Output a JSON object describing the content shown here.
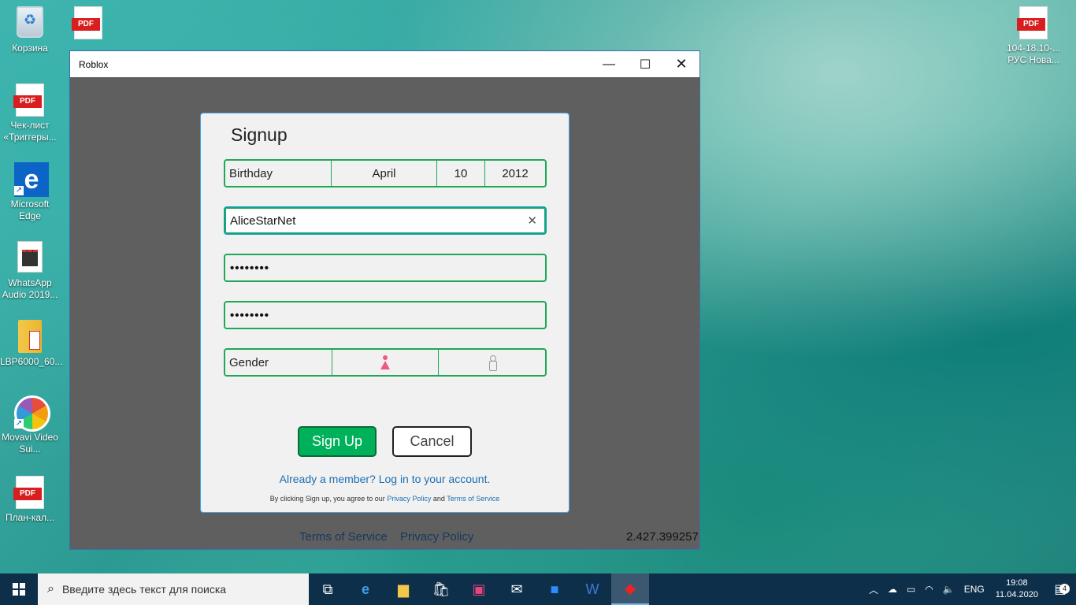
{
  "desktop": {
    "icons": [
      {
        "label": "Корзина"
      },
      {
        "label": "Чек-лист «Триггеры..."
      },
      {
        "label": "Microsoft Edge"
      },
      {
        "label": "WhatsApp Audio 2019..."
      },
      {
        "label": "LBP6000_60..."
      },
      {
        "label": "Movavi Video Sui..."
      },
      {
        "label": "План-кал..."
      },
      {
        "label": "104-18.10-... РУС Нова..."
      }
    ],
    "pdf_tag": "PDF"
  },
  "window": {
    "title": "Roblox",
    "minimize": "—",
    "maximize": "☐",
    "close": "✕"
  },
  "signup": {
    "heading": "Signup",
    "birthday": {
      "label": "Birthday",
      "month": "April",
      "day": "10",
      "year": "2012"
    },
    "username": {
      "value": "AliceStarNet",
      "clear": "✕"
    },
    "password": {
      "value": "••••••••"
    },
    "confirm_password": {
      "value": "••••••••"
    },
    "gender": {
      "label": "Gender"
    },
    "signup_button": "Sign Up",
    "cancel_button": "Cancel",
    "login_link": "Already a member? Log in to your account.",
    "legal_prefix": "By clicking Sign up, you agree to our",
    "privacy_link": "Privacy Policy",
    "legal_and": "and",
    "terms_link": "Terms of Service"
  },
  "footer": {
    "terms": "Terms of Service",
    "privacy": "Privacy Policy",
    "version": "2.427.399257"
  },
  "taskbar": {
    "search_placeholder": "Введите здесь текст для поиска",
    "language": "ENG",
    "time": "19:08",
    "date": "11.04.2020",
    "notification_count": "4"
  }
}
